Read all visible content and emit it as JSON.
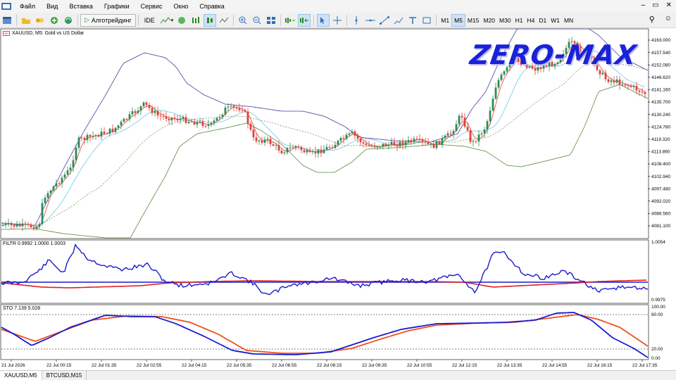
{
  "menu": [
    "Файл",
    "Вид",
    "Вставка",
    "Графики",
    "Сервис",
    "Окно",
    "Справка"
  ],
  "toolbar": {
    "algo_label": "Алготрейдинг",
    "ide_label": "IDE",
    "timeframes": [
      "M1",
      "M5",
      "M15",
      "M20",
      "M30",
      "H1",
      "H4",
      "D1",
      "W1",
      "MN"
    ],
    "active_timeframe": "M5"
  },
  "chart": {
    "symbol_label": "XAUUSD, M5:  Gold vs US Dollar",
    "watermark": "ZERO-MAX",
    "price_ticks": [
      "4163.000",
      "4157.540",
      "4152.080",
      "4146.620",
      "4141.160",
      "4135.700",
      "4130.240",
      "4124.780",
      "4119.320",
      "4113.860",
      "4108.400",
      "4102.940",
      "4097.480",
      "4092.020",
      "4086.560",
      "4081.100"
    ],
    "filtr_label": "FILTR 0.9992 1.0000 1.0003",
    "filtr_ticks": [
      "1.0054",
      "0.9975"
    ],
    "sto_label": "STO 7.139 5.028",
    "sto_ticks": [
      "100.00",
      "80.00",
      "20.00",
      "0.00"
    ],
    "time_ticks": [
      "21 Jul 2026",
      "22 Jul 00:15",
      "22 Jul 01:35",
      "22 Jul 02:55",
      "22 Jul 04:15",
      "22 Jul 05:35",
      "22 Jul 06:55",
      "22 Jul 08:15",
      "22 Jul 09:35",
      "22 Jul 10:55",
      "22 Jul 12:15",
      "22 Jul 13:35",
      "22 Jul 14:55",
      "22 Jul 16:15",
      "22 Jul 17:35"
    ],
    "colors": {
      "bull": "#2e8b57",
      "bear": "#e0413a",
      "band_upper": "#4b3aa0",
      "band_lower": "#5a8a3a",
      "ma_fast": "#e0413a",
      "ma_mid": "#6ec6e8",
      "filtr_blue": "#1a1ad0",
      "filtr_red": "#e02020",
      "sto_blue": "#1a1ad0",
      "sto_orange": "#f0501a"
    }
  },
  "tabs": [
    "XAUUSD,M5",
    "BTCUSD,M15"
  ],
  "active_tab": "XAUUSD,M5"
}
